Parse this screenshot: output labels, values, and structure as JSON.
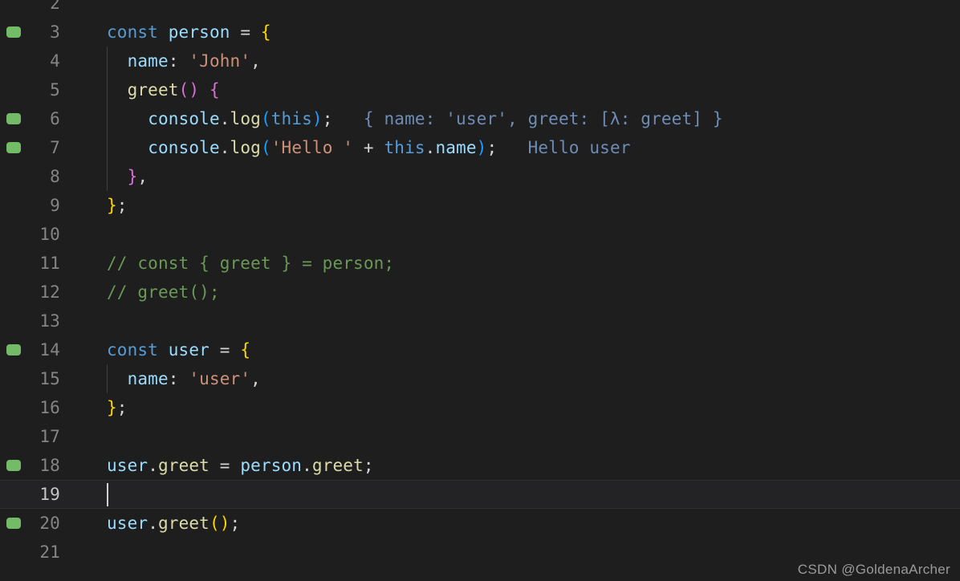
{
  "editor": {
    "theme_name": "dark-plus",
    "colors": {
      "background": "#1e1e1e",
      "active_line_background": "#232325",
      "line_number": "#858585",
      "active_line_number": "#c6c6c6",
      "marker_green": "#73bb67",
      "keyword": "#569cd6",
      "variable": "#9cdcfe",
      "function": "#dcdcaa",
      "string": "#ce9178",
      "comment": "#6a9955",
      "bracket_level1": "#ffd700",
      "bracket_level2": "#da70d6",
      "bracket_level3": "#179fff",
      "inline_hint": "#6e8cb4",
      "default_text": "#d4d4d4",
      "indent_guide": "#404040",
      "cursor": "#d0d0d0"
    },
    "first_visible_line": 2,
    "last_visible_line": 21,
    "active_line": 19,
    "cursor_line": 19,
    "cursor_column": 1,
    "lines": [
      {
        "number": "2",
        "marker": false,
        "active": false,
        "guide": false,
        "tokens": []
      },
      {
        "number": "3",
        "marker": true,
        "active": false,
        "guide": false,
        "tokens": [
          {
            "text": "const",
            "cls": "t-kw"
          },
          {
            "text": " ",
            "cls": "t-op"
          },
          {
            "text": "person",
            "cls": "t-var"
          },
          {
            "text": " ",
            "cls": "t-op"
          },
          {
            "text": "=",
            "cls": "t-op"
          },
          {
            "text": " ",
            "cls": "t-op"
          },
          {
            "text": "{",
            "cls": "t-br1"
          }
        ]
      },
      {
        "number": "4",
        "marker": false,
        "active": false,
        "guide": true,
        "tokens": [
          {
            "text": "  ",
            "cls": "t-op"
          },
          {
            "text": "name",
            "cls": "t-var"
          },
          {
            "text": ":",
            "cls": "t-punct"
          },
          {
            "text": " ",
            "cls": "t-op"
          },
          {
            "text": "'John'",
            "cls": "t-str"
          },
          {
            "text": ",",
            "cls": "t-punct"
          }
        ]
      },
      {
        "number": "5",
        "marker": false,
        "active": false,
        "guide": true,
        "tokens": [
          {
            "text": "  ",
            "cls": "t-op"
          },
          {
            "text": "greet",
            "cls": "t-fn"
          },
          {
            "text": "(",
            "cls": "t-br2"
          },
          {
            "text": ")",
            "cls": "t-br2"
          },
          {
            "text": " ",
            "cls": "t-op"
          },
          {
            "text": "{",
            "cls": "t-br2"
          }
        ]
      },
      {
        "number": "6",
        "marker": true,
        "active": false,
        "guide": true,
        "tokens": [
          {
            "text": "    ",
            "cls": "t-op"
          },
          {
            "text": "console",
            "cls": "t-var"
          },
          {
            "text": ".",
            "cls": "t-punct"
          },
          {
            "text": "log",
            "cls": "t-fn"
          },
          {
            "text": "(",
            "cls": "t-br3"
          },
          {
            "text": "this",
            "cls": "t-kw"
          },
          {
            "text": ")",
            "cls": "t-br3"
          },
          {
            "text": ";",
            "cls": "t-punct"
          },
          {
            "text": "   { name: 'user', greet: [λ: greet] }",
            "cls": "t-hint"
          }
        ]
      },
      {
        "number": "7",
        "marker": true,
        "active": false,
        "guide": true,
        "tokens": [
          {
            "text": "    ",
            "cls": "t-op"
          },
          {
            "text": "console",
            "cls": "t-var"
          },
          {
            "text": ".",
            "cls": "t-punct"
          },
          {
            "text": "log",
            "cls": "t-fn"
          },
          {
            "text": "(",
            "cls": "t-br3"
          },
          {
            "text": "'Hello '",
            "cls": "t-str"
          },
          {
            "text": " ",
            "cls": "t-op"
          },
          {
            "text": "+",
            "cls": "t-op"
          },
          {
            "text": " ",
            "cls": "t-op"
          },
          {
            "text": "this",
            "cls": "t-kw"
          },
          {
            "text": ".",
            "cls": "t-punct"
          },
          {
            "text": "name",
            "cls": "t-prop"
          },
          {
            "text": ")",
            "cls": "t-br3"
          },
          {
            "text": ";",
            "cls": "t-punct"
          },
          {
            "text": "   Hello user",
            "cls": "t-hint"
          }
        ]
      },
      {
        "number": "8",
        "marker": false,
        "active": false,
        "guide": true,
        "tokens": [
          {
            "text": "  ",
            "cls": "t-op"
          },
          {
            "text": "}",
            "cls": "t-br2"
          },
          {
            "text": ",",
            "cls": "t-punct"
          }
        ]
      },
      {
        "number": "9",
        "marker": false,
        "active": false,
        "guide": false,
        "tokens": [
          {
            "text": "}",
            "cls": "t-br1"
          },
          {
            "text": ";",
            "cls": "t-punct"
          }
        ]
      },
      {
        "number": "10",
        "marker": false,
        "active": false,
        "guide": false,
        "tokens": []
      },
      {
        "number": "11",
        "marker": false,
        "active": false,
        "guide": false,
        "tokens": [
          {
            "text": "// const { greet } = person;",
            "cls": "t-comment"
          }
        ]
      },
      {
        "number": "12",
        "marker": false,
        "active": false,
        "guide": false,
        "tokens": [
          {
            "text": "// greet();",
            "cls": "t-comment"
          }
        ]
      },
      {
        "number": "13",
        "marker": false,
        "active": false,
        "guide": false,
        "tokens": []
      },
      {
        "number": "14",
        "marker": true,
        "active": false,
        "guide": false,
        "tokens": [
          {
            "text": "const",
            "cls": "t-kw"
          },
          {
            "text": " ",
            "cls": "t-op"
          },
          {
            "text": "user",
            "cls": "t-var"
          },
          {
            "text": " ",
            "cls": "t-op"
          },
          {
            "text": "=",
            "cls": "t-op"
          },
          {
            "text": " ",
            "cls": "t-op"
          },
          {
            "text": "{",
            "cls": "t-br1"
          }
        ]
      },
      {
        "number": "15",
        "marker": false,
        "active": false,
        "guide": true,
        "tokens": [
          {
            "text": "  ",
            "cls": "t-op"
          },
          {
            "text": "name",
            "cls": "t-var"
          },
          {
            "text": ":",
            "cls": "t-punct"
          },
          {
            "text": " ",
            "cls": "t-op"
          },
          {
            "text": "'user'",
            "cls": "t-str"
          },
          {
            "text": ",",
            "cls": "t-punct"
          }
        ]
      },
      {
        "number": "16",
        "marker": false,
        "active": false,
        "guide": false,
        "tokens": [
          {
            "text": "}",
            "cls": "t-br1"
          },
          {
            "text": ";",
            "cls": "t-punct"
          }
        ]
      },
      {
        "number": "17",
        "marker": false,
        "active": false,
        "guide": false,
        "tokens": []
      },
      {
        "number": "18",
        "marker": true,
        "active": false,
        "guide": false,
        "tokens": [
          {
            "text": "user",
            "cls": "t-var"
          },
          {
            "text": ".",
            "cls": "t-punct"
          },
          {
            "text": "greet",
            "cls": "t-fn"
          },
          {
            "text": " ",
            "cls": "t-op"
          },
          {
            "text": "=",
            "cls": "t-op"
          },
          {
            "text": " ",
            "cls": "t-op"
          },
          {
            "text": "person",
            "cls": "t-var"
          },
          {
            "text": ".",
            "cls": "t-punct"
          },
          {
            "text": "greet",
            "cls": "t-fn"
          },
          {
            "text": ";",
            "cls": "t-punct"
          }
        ]
      },
      {
        "number": "19",
        "marker": false,
        "active": true,
        "guide": false,
        "cursor": true,
        "tokens": []
      },
      {
        "number": "20",
        "marker": true,
        "active": false,
        "guide": false,
        "tokens": [
          {
            "text": "user",
            "cls": "t-var"
          },
          {
            "text": ".",
            "cls": "t-punct"
          },
          {
            "text": "greet",
            "cls": "t-fn"
          },
          {
            "text": "(",
            "cls": "t-br1"
          },
          {
            "text": ")",
            "cls": "t-br1"
          },
          {
            "text": ";",
            "cls": "t-punct"
          }
        ]
      },
      {
        "number": "21",
        "marker": false,
        "active": false,
        "guide": false,
        "tokens": []
      }
    ]
  },
  "watermark": {
    "text": "CSDN @GoldenaArcher"
  }
}
